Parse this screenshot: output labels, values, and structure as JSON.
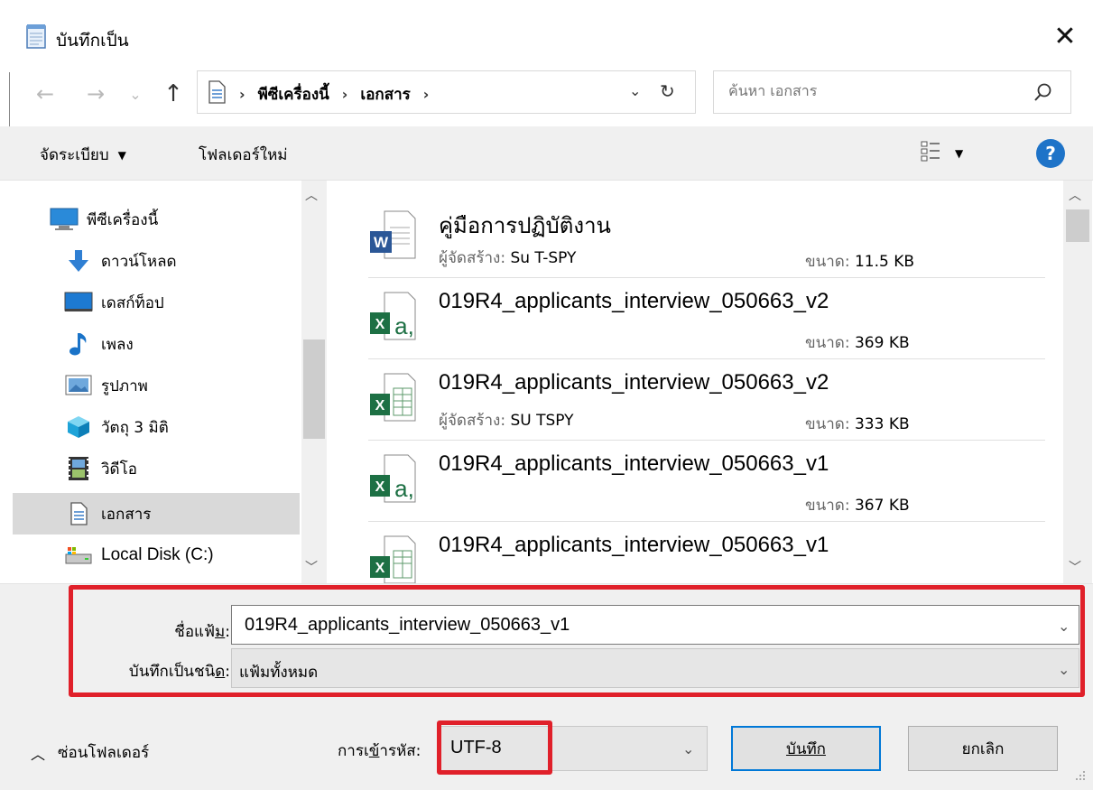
{
  "window": {
    "title": "บันทึกเป็น"
  },
  "address": {
    "crumbs": [
      "พีซีเครื่องนี้",
      "เอกสาร"
    ]
  },
  "search": {
    "placeholder": "ค้นหา เอกสาร"
  },
  "toolbar": {
    "organize_label": "จัดระเบียบ",
    "new_folder_label": "โฟลเดอร์ใหม่",
    "help_label": "?"
  },
  "nav": {
    "items": [
      {
        "label": "พีซีเครื่องนี้",
        "icon": "computer-icon"
      },
      {
        "label": "ดาวน์โหลด",
        "icon": "download-icon"
      },
      {
        "label": "เดสก์ท็อป",
        "icon": "desktop-icon"
      },
      {
        "label": "เพลง",
        "icon": "music-icon"
      },
      {
        "label": "รูปภาพ",
        "icon": "pictures-icon"
      },
      {
        "label": "วัตถุ 3 มิติ",
        "icon": "3d-objects-icon"
      },
      {
        "label": "วิดีโอ",
        "icon": "video-icon"
      },
      {
        "label": "เอกสาร",
        "icon": "documents-icon",
        "selected": true
      },
      {
        "label": "Local Disk (C:)",
        "icon": "disk-icon"
      }
    ]
  },
  "files": [
    {
      "name": "คู่มือการปฏิบัติงาน",
      "author_label": "ผู้จัดสร้าง:",
      "author": "Su T-SPY",
      "size_label": "ขนาด:",
      "size": "11.5 KB",
      "type": "word"
    },
    {
      "name": "019R4_applicants_interview_050663_v2",
      "author_label": "",
      "author": "",
      "size_label": "ขนาด:",
      "size": "369 KB",
      "type": "excel-csv"
    },
    {
      "name": "019R4_applicants_interview_050663_v2",
      "author_label": "ผู้จัดสร้าง:",
      "author": "SU TSPY",
      "size_label": "ขนาด:",
      "size": "333 KB",
      "type": "excel"
    },
    {
      "name": "019R4_applicants_interview_050663_v1",
      "author_label": "",
      "author": "",
      "size_label": "ขนาด:",
      "size": "367 KB",
      "type": "excel-csv"
    },
    {
      "name": "019R4_applicants_interview_050663_v1",
      "author_label": "",
      "author": "",
      "size_label": "",
      "size": "",
      "type": "excel"
    }
  ],
  "form": {
    "filename_label_pre": "ชื่อแฟ้",
    "filename_label_u": "ม",
    "filename_label_post": ":",
    "filename_value": "019R4_applicants_interview_050663_v1",
    "filetype_label_pre": "บันทึกเป็นชนิ",
    "filetype_label_u": "ด",
    "filetype_label_post": ":",
    "filetype_value": "แฟ้มทั้งหมด",
    "hide_folders_label": "ซ่อนโฟลเดอร์",
    "encoding_label_pre": "การเ",
    "encoding_label_u": "ข้",
    "encoding_label_post": "ารหัส:",
    "encoding_value": "UTF-8",
    "save_label": "บันทึก",
    "cancel_label": "ยกเลิก"
  },
  "colors": {
    "highlight": "#e0202a",
    "accent": "#0078d7",
    "selected": "#d9d9d9"
  }
}
